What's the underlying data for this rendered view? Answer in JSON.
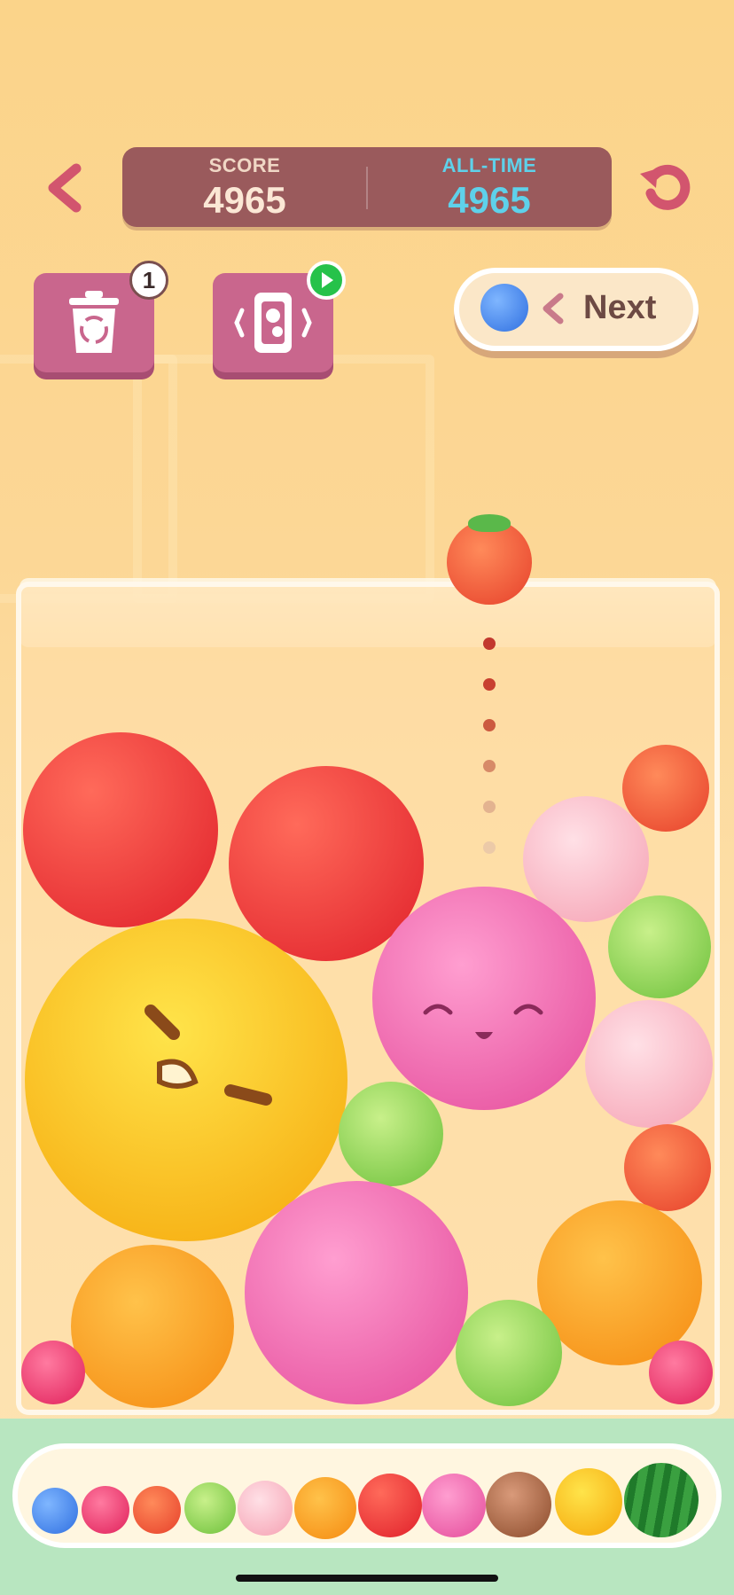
{
  "scoreboard": {
    "score_label": "SCORE",
    "score_value": "4965",
    "alltime_label": "ALL-TIME",
    "alltime_value": "4965"
  },
  "tools": {
    "trash_badge": "1"
  },
  "next": {
    "label": "Next",
    "fruit": "blueberry"
  },
  "current_drop": "strawberry",
  "jar_fruits": [
    "apple",
    "apple",
    "strawberry",
    "peach",
    "pomegranate",
    "lime",
    "pineapple",
    "peach",
    "lime",
    "strawberry",
    "pomegranate",
    "orange",
    "orange",
    "lime",
    "raspberry",
    "raspberry"
  ],
  "evolution_chain": [
    "blueberry",
    "raspberry",
    "strawberry",
    "lime",
    "peach",
    "orange",
    "apple",
    "pomegranate",
    "coconut",
    "pineapple",
    "watermelon"
  ],
  "colors": {
    "score_bar": "#9a5a5c",
    "alltime_text": "#5ed1ea",
    "tool_button": "#c9668d",
    "tray": "#b8e6c0"
  }
}
